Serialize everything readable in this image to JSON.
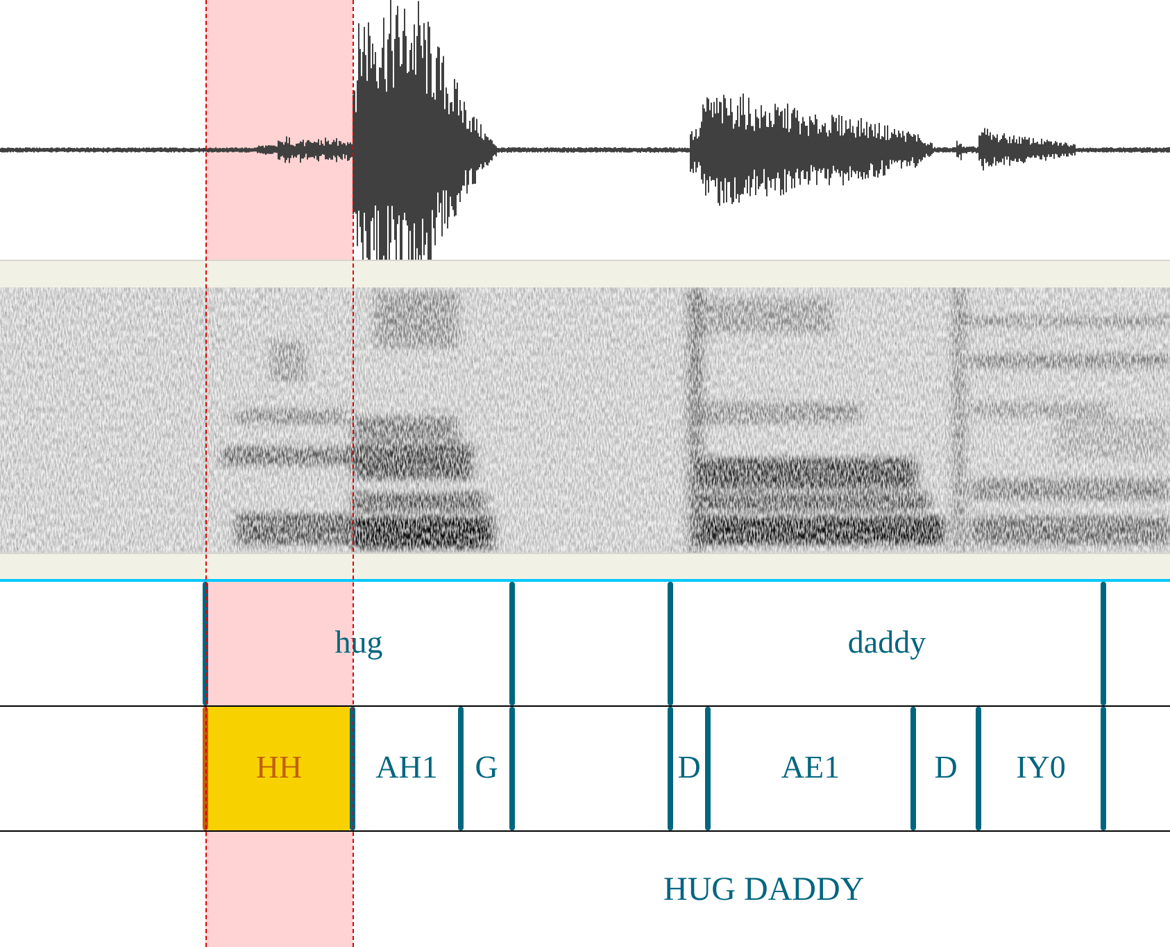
{
  "word_tier": [
    {
      "label": "hug"
    },
    {
      "label": "daddy"
    }
  ],
  "phone_tier": [
    {
      "label": "HH",
      "selected": true
    },
    {
      "label": "AH1",
      "selected": false
    },
    {
      "label": "G",
      "selected": false
    },
    {
      "label": "D",
      "selected": false
    },
    {
      "label": "AE1",
      "selected": false
    },
    {
      "label": "D",
      "selected": false
    },
    {
      "label": "IY0",
      "selected": false
    }
  ],
  "text_tier": {
    "label": "HUG DADDY"
  }
}
